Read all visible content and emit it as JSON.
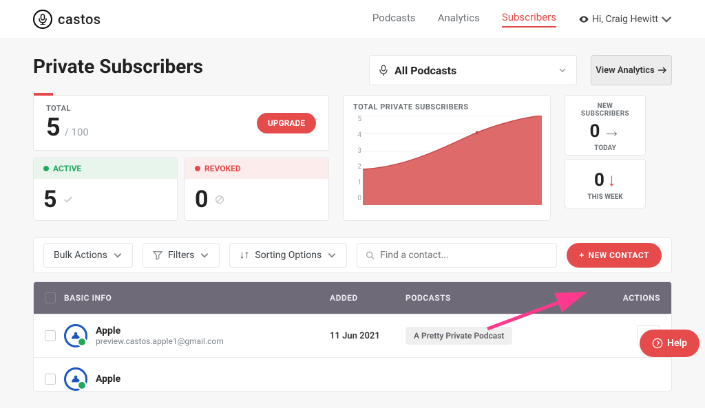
{
  "brand": {
    "name": "castos"
  },
  "nav": {
    "items": [
      {
        "label": "Podcasts",
        "active": false
      },
      {
        "label": "Analytics",
        "active": false
      },
      {
        "label": "Subscribers",
        "active": true
      }
    ],
    "user_greeting": "Hi, Craig Hewitt"
  },
  "page": {
    "title": "Private Subscribers",
    "podcast_selector": "All Podcasts",
    "analytics_btn": "View Analytics"
  },
  "cards": {
    "total": {
      "label": "TOTAL",
      "value": "5",
      "limit": "/ 100",
      "upgrade": "UPGRADE"
    },
    "active": {
      "label": "ACTIVE",
      "value": "5"
    },
    "revoked": {
      "label": "REVOKED",
      "value": "0"
    },
    "chart_label": "TOTAL PRIVATE SUBSCRIBERS",
    "new": {
      "label": "NEW SUBSCRIBERS",
      "today": {
        "value": "0",
        "caption": "TODAY"
      },
      "week": {
        "value": "0",
        "caption": "THIS WEEK"
      }
    }
  },
  "toolbar": {
    "bulk": "Bulk Actions",
    "filters": "Filters",
    "sort": "Sorting Options",
    "search_placeholder": "Find a contact...",
    "new_contact": "NEW CONTACT"
  },
  "table": {
    "headers": {
      "basic": "BASIC INFO",
      "added": "ADDED",
      "podcasts": "PODCASTS",
      "actions": "ACTIONS"
    },
    "rows": [
      {
        "name": "Apple",
        "email": "preview.castos.apple1@gmail.com",
        "added": "11 Jun 2021",
        "podcast": "A Pretty Private Podcast"
      },
      {
        "name": "Apple",
        "email": "",
        "added": "",
        "podcast": ""
      }
    ]
  },
  "help": "Help",
  "chart_data": {
    "type": "area",
    "title": "TOTAL PRIVATE SUBSCRIBERS",
    "ylabel": "",
    "xlabel": "",
    "ylim": [
      0,
      5
    ],
    "y_ticks": [
      5,
      4,
      3,
      2,
      1,
      0
    ],
    "values": [
      2.0,
      2.1,
      2.4,
      2.8,
      3.2,
      3.6,
      3.9,
      4.2,
      4.5,
      4.7,
      4.9,
      5.0
    ]
  }
}
